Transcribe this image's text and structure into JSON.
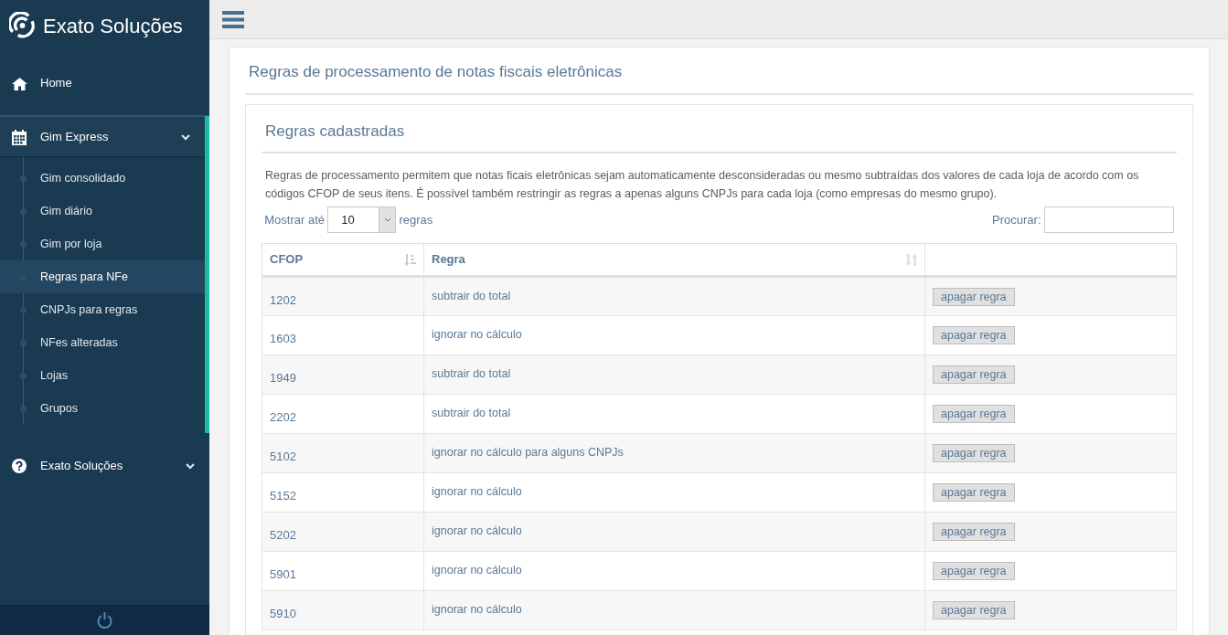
{
  "brand": {
    "title": "Exato Soluções"
  },
  "sidebar": {
    "items": [
      {
        "label": "Home",
        "expanded": false
      },
      {
        "label": "Gim Express",
        "expanded": true,
        "children": [
          {
            "label": "Gim consolidado",
            "selected": false
          },
          {
            "label": "Gim diário",
            "selected": false
          },
          {
            "label": "Gim por loja",
            "selected": false
          },
          {
            "label": "Regras para NFe",
            "selected": true
          },
          {
            "label": "CNPJs para regras",
            "selected": false
          },
          {
            "label": "NFes alteradas",
            "selected": false
          },
          {
            "label": "Lojas",
            "selected": false
          },
          {
            "label": "Grupos",
            "selected": false
          }
        ]
      },
      {
        "label": "Exato Soluções",
        "expanded": false
      }
    ]
  },
  "page_title": "Regras de processamento de notas fiscais eletrônicas",
  "card": {
    "title": "Regras cadastradas",
    "description": "Regras de processamento permitem que notas ficais eletrônicas sejam automaticamente desconsideradas ou mesmo subtraídas dos valores de cada loja de acordo com os códigos CFOP de seus itens. É possível também restringir as regras a apenas alguns CNPJs para cada loja (como empresas do mesmo grupo).",
    "length_prefix": "Mostrar até",
    "length_value": "10",
    "length_suffix": "regras",
    "search_label": "Procurar:",
    "table": {
      "columns": [
        {
          "label": "CFOP",
          "sorted": true
        },
        {
          "label": "Regra",
          "sorted": false
        },
        {}
      ],
      "rows": [
        {
          "cfop": "1202",
          "rule": "subtrair do total",
          "action": "apagar regra"
        },
        {
          "cfop": "1603",
          "rule": "ignorar no cálculo",
          "action": "apagar regra"
        },
        {
          "cfop": "1949",
          "rule": "subtrair do total",
          "action": "apagar regra"
        },
        {
          "cfop": "2202",
          "rule": "subtrair do total",
          "action": "apagar regra"
        },
        {
          "cfop": "5102",
          "rule": "ignorar no cálculo para alguns CNPJs",
          "action": "apagar regra"
        },
        {
          "cfop": "5152",
          "rule": "ignorar no cálculo",
          "action": "apagar regra"
        },
        {
          "cfop": "5202",
          "rule": "ignorar no cálculo",
          "action": "apagar regra"
        },
        {
          "cfop": "5901",
          "rule": "ignorar no cálculo",
          "action": "apagar regra"
        },
        {
          "cfop": "5910",
          "rule": "ignorar no cálculo",
          "action": "apagar regra"
        }
      ]
    }
  }
}
